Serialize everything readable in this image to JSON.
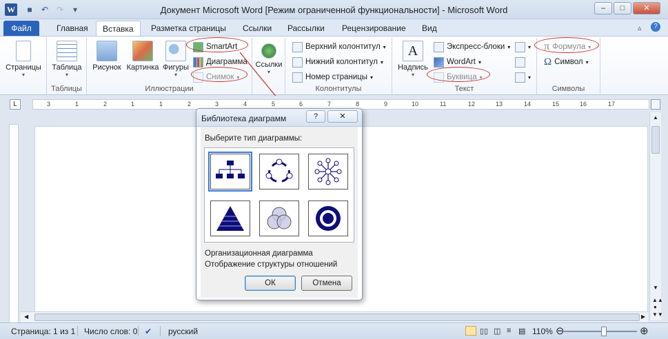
{
  "window": {
    "title": "Документ Microsoft Word [Режим ограниченной функциональности]  -  Microsoft Word",
    "app_icon": "W"
  },
  "tabs": [
    "Файл",
    "Главная",
    "Вставка",
    "Разметка страницы",
    "Ссылки",
    "Рассылки",
    "Рецензирование",
    "Вид"
  ],
  "ribbon": {
    "pages": {
      "label": "Страницы"
    },
    "tables": {
      "button": "Таблица",
      "group": "Таблицы"
    },
    "illustrations": {
      "picture": "Рисунок",
      "clipart": "Картинка",
      "shapes": "Фигуры",
      "smartart": "SmartArt",
      "chart": "Диаграмма",
      "screenshot": "Снимок",
      "group": "Иллюстрации"
    },
    "links": {
      "button": "Ссылки"
    },
    "header_footer": {
      "header": "Верхний колонтитул",
      "footer": "Нижний колонтитул",
      "page_number": "Номер страницы",
      "group": "Колонтитулы"
    },
    "text": {
      "textbox": "Надпись",
      "quick_parts": "Экспресс-блоки",
      "wordart": "WordArt",
      "dropcap": "Буквица",
      "group": "Текст"
    },
    "symbols": {
      "equation": "Формула",
      "symbol": "Символ",
      "group": "Символы"
    }
  },
  "ruler": {
    "numbers": [
      "3",
      "1",
      "2",
      "1",
      "1",
      "2",
      "3",
      "4",
      "5",
      "6",
      "7",
      "8",
      "9",
      "10",
      "11",
      "12",
      "13",
      "14",
      "15",
      "16",
      "17"
    ]
  },
  "dialog": {
    "title": "Библиотека диаграмм",
    "help": "?",
    "close": "✕",
    "prompt": "Выберите тип диаграммы:",
    "selected_name": "Организационная диаграмма",
    "selected_desc": "Отображение структуры отношений",
    "ok": "ОК",
    "cancel": "Отмена"
  },
  "status": {
    "page": "Страница: 1 из 1",
    "words": "Число слов: 0",
    "lang": "русский",
    "zoom": "110%",
    "zoom_level": 1.1
  },
  "colors": {
    "file_tab": "#2a64b8",
    "highlight_ellipse": "#c9302c",
    "diagram_fill": "#0d0d7a"
  }
}
